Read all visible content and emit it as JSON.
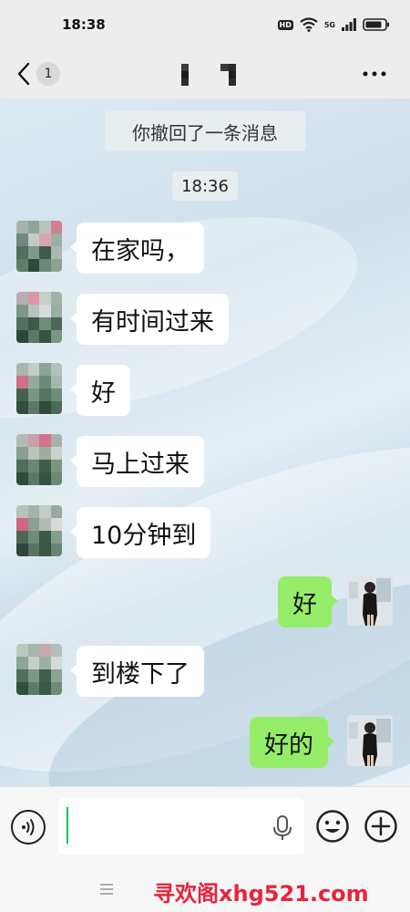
{
  "status_bar": {
    "time": "18:38",
    "hd_label": "HD",
    "signal_label": "5G"
  },
  "header": {
    "back_count": "1"
  },
  "chat": {
    "system_tip": "你撤回了一条消息",
    "timestamp": "18:36",
    "messages": [
      {
        "side": "in",
        "text": "在家吗，"
      },
      {
        "side": "in",
        "text": "有时间过来"
      },
      {
        "side": "in",
        "text": "好"
      },
      {
        "side": "in",
        "text": "马上过来"
      },
      {
        "side": "in",
        "text": "10分钟到"
      },
      {
        "side": "out",
        "text": "好"
      },
      {
        "side": "in",
        "text": "到楼下了"
      },
      {
        "side": "out",
        "text": "好的"
      }
    ]
  },
  "input": {
    "value": ""
  },
  "bottom": {
    "watermark": "寻欢阁xhg521.com"
  },
  "colors": {
    "incoming_bubble": "#ffffff",
    "outgoing_bubble": "#95ec69",
    "accent": "#07c160",
    "watermark": "#e8233c"
  }
}
